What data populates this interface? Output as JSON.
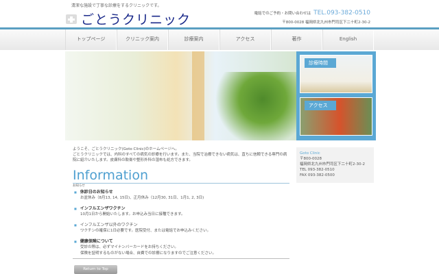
{
  "header": {
    "tagline": "清潔な施設で丁寧な診療をするクリニックです。",
    "logo": "ごとうクリニック",
    "contact_label": "電話でのご予約・お問い合わせは",
    "tel": "TEL.093-382-0510",
    "address": "〒800-0028 福岡県北九州市門司区下二十町2-30-2"
  },
  "nav": [
    "トップページ",
    "クリニック案内",
    "診療案内",
    "アクセス",
    "著作",
    "English"
  ],
  "side_banners": [
    "診療時間",
    "アクセス"
  ],
  "intro": [
    "ようこそ、ごとうクリニック(Goto Clinic)のホームページへ。",
    "ごとうクリニックでは、内科のすべての病気の診療を行います。また、当院で治療できない病気は、直ちに信頼できる専門の病院に紹介いたします。皮膚科の軟膏や整形外科の湿布も処方できます。"
  ],
  "information": {
    "title": "Information",
    "subtitle": "お知らせ",
    "items": [
      {
        "heading": "休診日のお知らせ",
        "bold": true,
        "body": [
          "お盆休み（8月13, 14, 15日)、正月休み（12月30, 31日、1月1, 2, 3日)"
        ]
      },
      {
        "heading": "インフルエンザワクチン",
        "bold": true,
        "body": [
          "10月1日から開始いたします。お申込み当日に接種できます。"
        ]
      },
      {
        "heading": "インフルエンザ以外のワクチン",
        "bold": false,
        "body": [
          "ワクチンの確保に1日必要です。医院受付、または電話でお申込みください。"
        ]
      },
      {
        "heading": "健康保険について",
        "bold": true,
        "body": [
          "受診の際は、必ずマイナンバーカードをお持ちください。",
          "保険を証明するものがない場合、自費での診療になりますのでご注意ください。"
        ]
      }
    ]
  },
  "return_to_top": "Return to Top",
  "sidebar_address": {
    "name": "Goto Clinic",
    "zip": "〒800-0028",
    "address": "福岡県北九州市門司区下二十町2-30-2",
    "tel": "TEL 093-382-0510",
    "fax": "FAX 093-382-0500"
  }
}
